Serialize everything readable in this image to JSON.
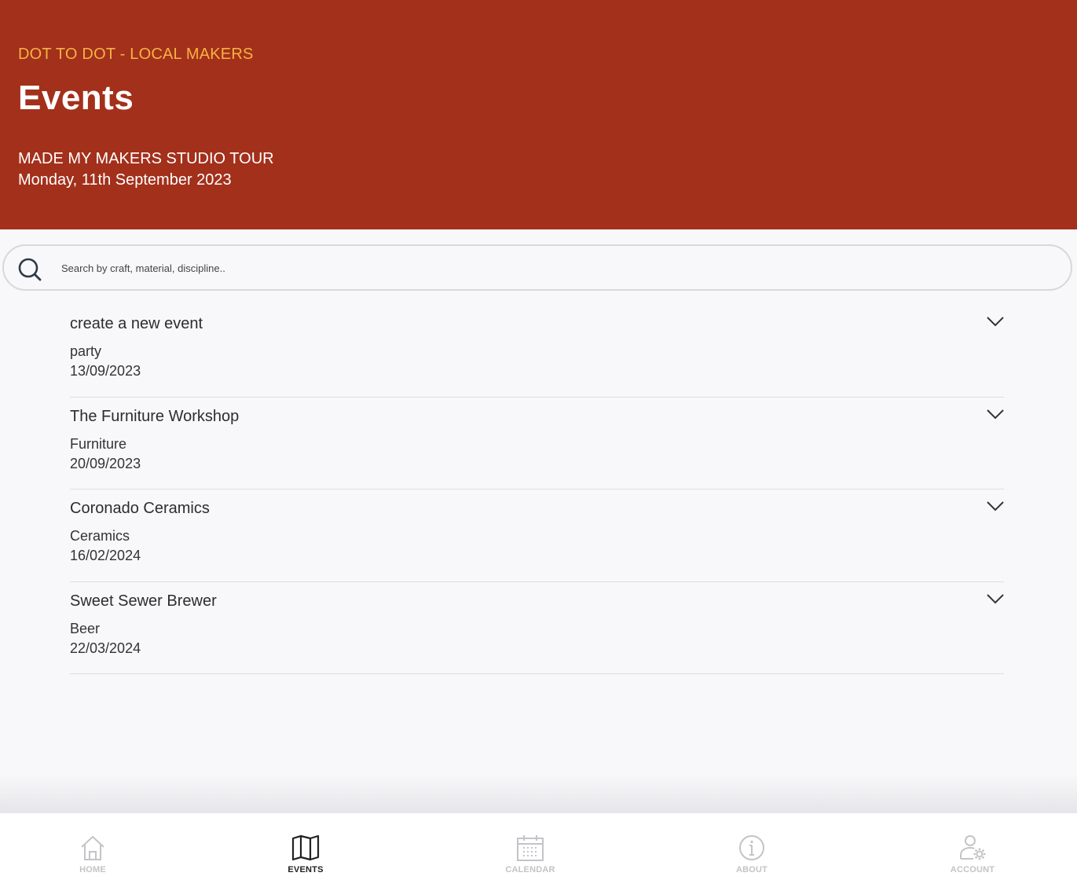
{
  "header": {
    "brand": "DOT TO DOT - LOCAL MAKERS",
    "title": "Events",
    "tour_name": "MADE MY MAKERS STUDIO TOUR",
    "tour_date": "Monday, 11th September 2023",
    "background_color": "#a3301b",
    "brand_color": "#f5b342"
  },
  "search": {
    "placeholder": "Search by craft, material, discipline..",
    "value": "",
    "icon": "search-icon"
  },
  "events": [
    {
      "title": "create a new event",
      "category": "party",
      "date": "13/09/2023"
    },
    {
      "title": "The Furniture Workshop",
      "category": "Furniture",
      "date": "20/09/2023"
    },
    {
      "title": "Coronado Ceramics",
      "category": "Ceramics",
      "date": "16/02/2024"
    },
    {
      "title": "Sweet Sewer Brewer",
      "category": "Beer",
      "date": "22/03/2024"
    }
  ],
  "tabbar": {
    "tabs": [
      {
        "label": "HOME",
        "icon": "home-icon",
        "active": false
      },
      {
        "label": "EVENTS",
        "icon": "map-icon",
        "active": true
      },
      {
        "label": "CALENDAR",
        "icon": "calendar-icon",
        "active": false
      },
      {
        "label": "ABOUT",
        "icon": "info-icon",
        "active": false
      },
      {
        "label": "ACCOUNT",
        "icon": "account-settings-icon",
        "active": false
      }
    ]
  }
}
